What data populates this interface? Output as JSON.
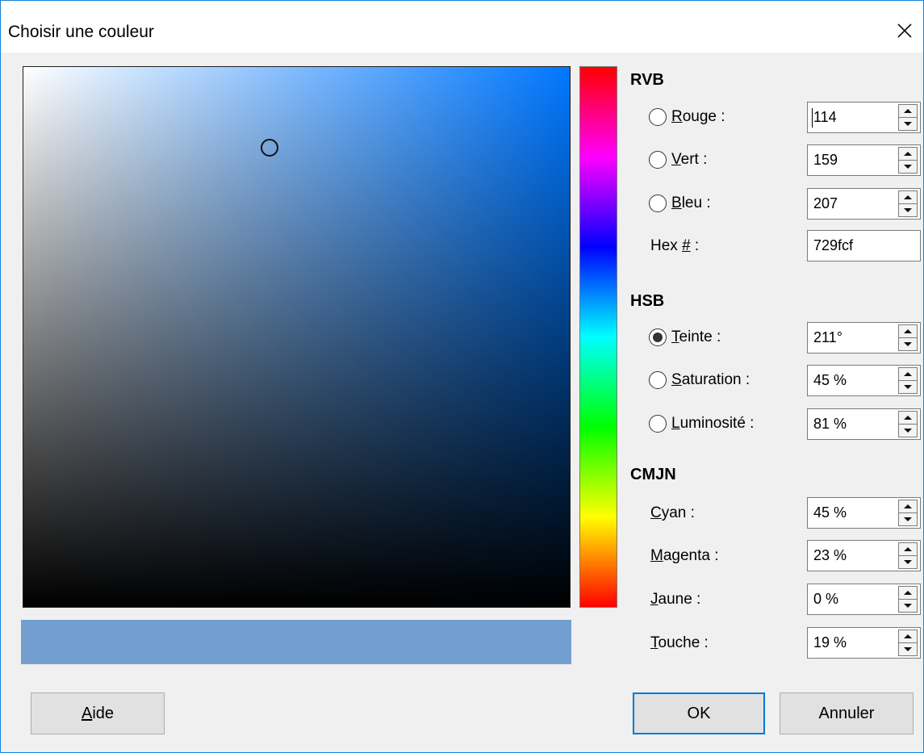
{
  "window": {
    "title": "Choisir une couleur"
  },
  "preview": {
    "color": "#729fcf"
  },
  "rgb": {
    "title": "RVB",
    "red": {
      "key": "R",
      "rest": "ouge :",
      "value": "114"
    },
    "green": {
      "key": "V",
      "rest": "ert :",
      "value": "159"
    },
    "blue": {
      "key": "B",
      "rest": "leu :",
      "value": "207"
    },
    "hex": {
      "pre": "Hex ",
      "key": "#",
      "rest": " :",
      "value": "729fcf"
    }
  },
  "hsb": {
    "title": "HSB",
    "hue": {
      "key": "T",
      "rest": "einte :",
      "value": "211°",
      "checked": true
    },
    "saturation": {
      "key": "S",
      "rest": "aturation :",
      "value": "45 %"
    },
    "brightness": {
      "key": "L",
      "rest": "uminosité :",
      "value": "81 %"
    }
  },
  "cmyk": {
    "title": "CMJN",
    "cyan": {
      "key": "C",
      "rest": "yan :",
      "value": "45 %"
    },
    "magenta": {
      "key": "M",
      "rest": "agenta :",
      "value": "23 %"
    },
    "yellow": {
      "key": "J",
      "rest": "aune :",
      "value": "0 %"
    },
    "key": {
      "key": "T",
      "rest": "ouche :",
      "value": "19 %"
    }
  },
  "buttons": {
    "help": {
      "key": "A",
      "rest": "ide"
    },
    "ok": "OK",
    "cancel": "Annuler"
  }
}
